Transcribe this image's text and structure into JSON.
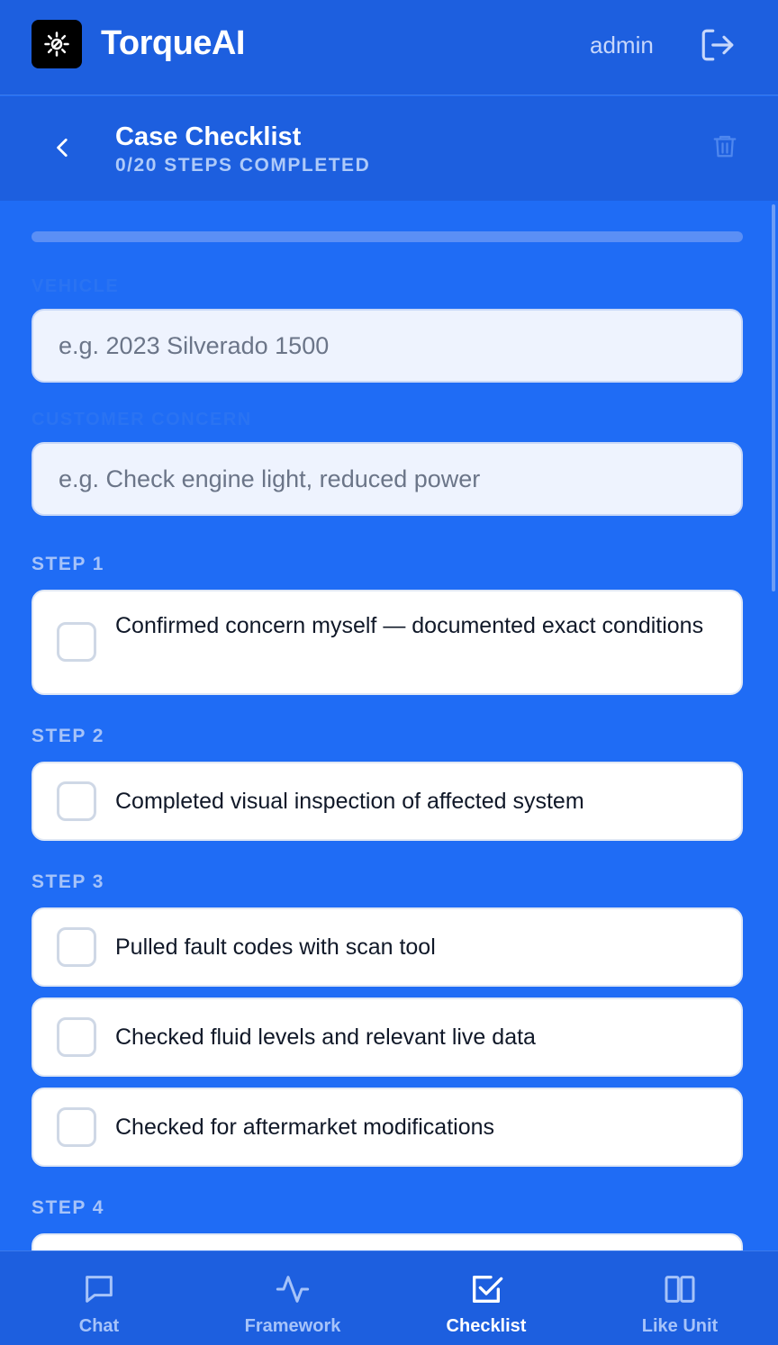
{
  "app": {
    "title": "TorqueAI",
    "user": "admin",
    "logo_icon": "gear-wrench-icon",
    "logout_icon": "logout-icon"
  },
  "subheader": {
    "title": "Case Checklist",
    "subtitle": "0/20 STEPS COMPLETED",
    "back_icon": "chevron-left-icon",
    "delete_icon": "trash-icon"
  },
  "progress": {
    "completed": 0,
    "total": 20
  },
  "form": {
    "vehicle": {
      "label": "VEHICLE",
      "placeholder": "e.g. 2023 Silverado 1500",
      "value": ""
    },
    "concern": {
      "label": "CUSTOMER CONCERN",
      "placeholder": "e.g. Check engine light, reduced power",
      "value": ""
    }
  },
  "steps": [
    {
      "label": "STEP 1",
      "items": [
        {
          "text": "Confirmed concern myself — documented exact conditions",
          "checked": false
        }
      ]
    },
    {
      "label": "STEP 2",
      "items": [
        {
          "text": "Completed visual inspection of affected system",
          "checked": false
        }
      ]
    },
    {
      "label": "STEP 3",
      "items": [
        {
          "text": "Pulled fault codes with scan tool",
          "checked": false
        },
        {
          "text": "Checked fluid levels and relevant live data",
          "checked": false
        },
        {
          "text": "Checked for aftermarket modifications",
          "checked": false
        }
      ]
    },
    {
      "label": "STEP 4",
      "items": []
    }
  ],
  "nav": {
    "items": [
      {
        "label": "Chat",
        "icon": "chat-bubble-icon",
        "active": false
      },
      {
        "label": "Framework",
        "icon": "activity-pulse-icon",
        "active": false
      },
      {
        "label": "Checklist",
        "icon": "checkbox-icon",
        "active": true
      },
      {
        "label": "Like Unit",
        "icon": "columns-icon",
        "active": false
      }
    ]
  },
  "colors": {
    "background": "#1f6cf5",
    "header": "#1d5fdf",
    "card": "#ffffff",
    "muted_label": "#a6c3f9"
  }
}
